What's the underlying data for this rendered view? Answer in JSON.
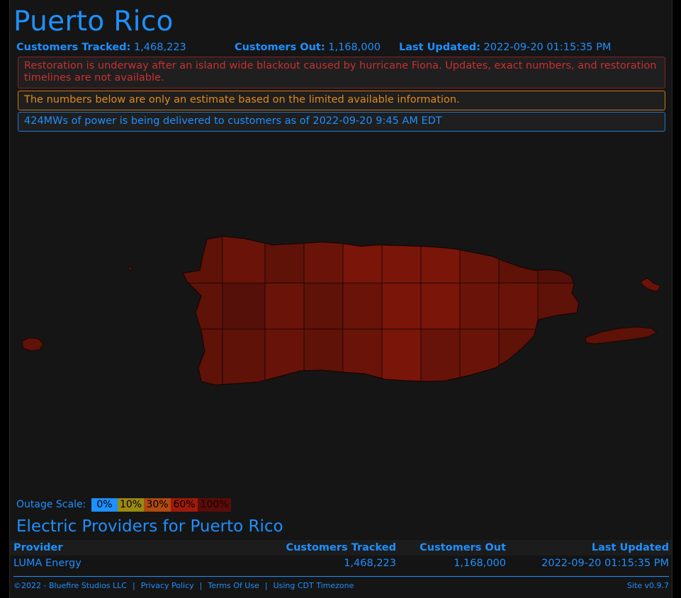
{
  "page": {
    "title": "Puerto Rico"
  },
  "stats": {
    "tracked_label": "Customers Tracked:",
    "tracked_value": "1,468,223",
    "out_label": "Customers Out:",
    "out_value": "1,168,000",
    "updated_label": "Last Updated:",
    "updated_value": "2022-09-20 01:15:35 PM"
  },
  "alerts": {
    "danger": "Restoration is underway after an island wide blackout caused by hurricane Fiona. Updates, exact numbers, and restoration timelines are not available.",
    "warning": "The numbers below are only an estimate based on the limited available information.",
    "info": "424MWs of power is being delivered to customers as of 2022-09-20 9:45 AM EDT"
  },
  "map": {
    "region_colors": [
      "#5e1208",
      "#6a1409",
      "#7a150a",
      "#55100a",
      "#681309"
    ]
  },
  "scale": {
    "label": "Outage Scale:",
    "items": [
      {
        "label": "0%",
        "color": "#1e90ff",
        "text": "#000000"
      },
      {
        "label": "10%",
        "color": "#9b8a10",
        "text": "#000000"
      },
      {
        "label": "30%",
        "color": "#b04a10",
        "text": "#000000"
      },
      {
        "label": "60%",
        "color": "#a01a0a",
        "text": "#000000"
      },
      {
        "label": "100%",
        "color": "#5a0c08",
        "text": "#1a0000"
      }
    ]
  },
  "providers": {
    "title": "Electric Providers for Puerto Rico",
    "headers": [
      "Provider",
      "Customers Tracked",
      "Customers Out",
      "Last Updated"
    ],
    "rows": [
      [
        "LUMA Energy",
        "1,468,223",
        "1,168,000",
        "2022-09-20 01:15:35 PM"
      ]
    ]
  },
  "footer": {
    "copyright": "©2022 - Bluefire Studios LLC",
    "sep": "|",
    "privacy": "Privacy Policy",
    "terms": "Terms Of Use",
    "timezone": "Using CDT Timezone",
    "version": "Site v0.9.7"
  }
}
